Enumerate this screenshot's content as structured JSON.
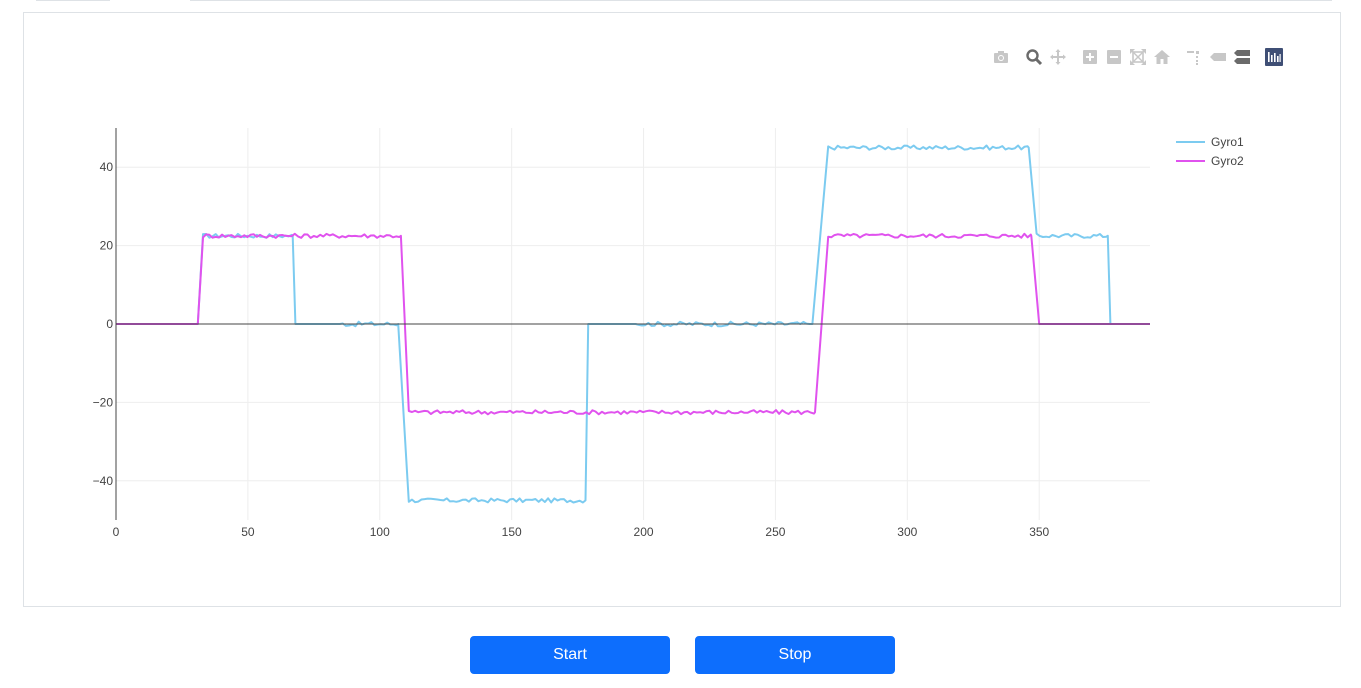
{
  "modebar": {
    "buttons": [
      {
        "icon": "camera-icon"
      },
      {
        "icon": "zoom-icon"
      },
      {
        "icon": "pan-icon"
      },
      {
        "icon": "zoom-in-icon"
      },
      {
        "icon": "zoom-out-icon"
      },
      {
        "icon": "autoscale-icon"
      },
      {
        "icon": "reset-axes-icon"
      },
      {
        "icon": "spike-lines-icon"
      },
      {
        "icon": "hover-closest-icon"
      },
      {
        "icon": "hover-compare-icon"
      },
      {
        "icon": "plotly-logo-icon"
      }
    ]
  },
  "controls": {
    "start_label": "Start",
    "stop_label": "Stop"
  },
  "colors": {
    "gyro1": "#7ccbf0",
    "gyro2": "#e052ee",
    "button": "#0d6efd",
    "grid": "#eeeeee",
    "axis": "#444444"
  },
  "chart_data": {
    "type": "line",
    "title": "",
    "xlabel": "",
    "ylabel": "",
    "xlim": [
      0,
      392
    ],
    "ylim": [
      -50,
      50
    ],
    "x_ticks": [
      0,
      50,
      100,
      150,
      200,
      250,
      300,
      350
    ],
    "y_ticks": [
      40,
      20,
      0,
      -20,
      -40
    ],
    "y_tick_labels": [
      "40",
      "20",
      "0",
      "−20",
      "−40"
    ],
    "grid": true,
    "legend_position": "top-right",
    "series": [
      {
        "name": "Gyro1",
        "color": "#7ccbf0",
        "segments": [
          [
            0,
            0
          ],
          [
            31,
            0
          ],
          [
            33,
            22.5
          ],
          [
            67,
            22.5
          ],
          [
            68,
            0
          ],
          [
            107,
            0
          ],
          [
            111,
            -45
          ],
          [
            178,
            -45
          ],
          [
            179,
            0
          ],
          [
            264,
            0
          ],
          [
            270,
            45
          ],
          [
            346,
            45
          ],
          [
            349,
            22.5
          ],
          [
            376,
            22.5
          ],
          [
            377,
            0
          ],
          [
            392,
            0
          ]
        ]
      },
      {
        "name": "Gyro2",
        "color": "#e052ee",
        "segments": [
          [
            0,
            0
          ],
          [
            31,
            0
          ],
          [
            33,
            22.5
          ],
          [
            108,
            22.5
          ],
          [
            111,
            -22.5
          ],
          [
            265,
            -22.5
          ],
          [
            270,
            22.5
          ],
          [
            347,
            22.5
          ],
          [
            350,
            0
          ],
          [
            392,
            0
          ]
        ]
      }
    ]
  }
}
